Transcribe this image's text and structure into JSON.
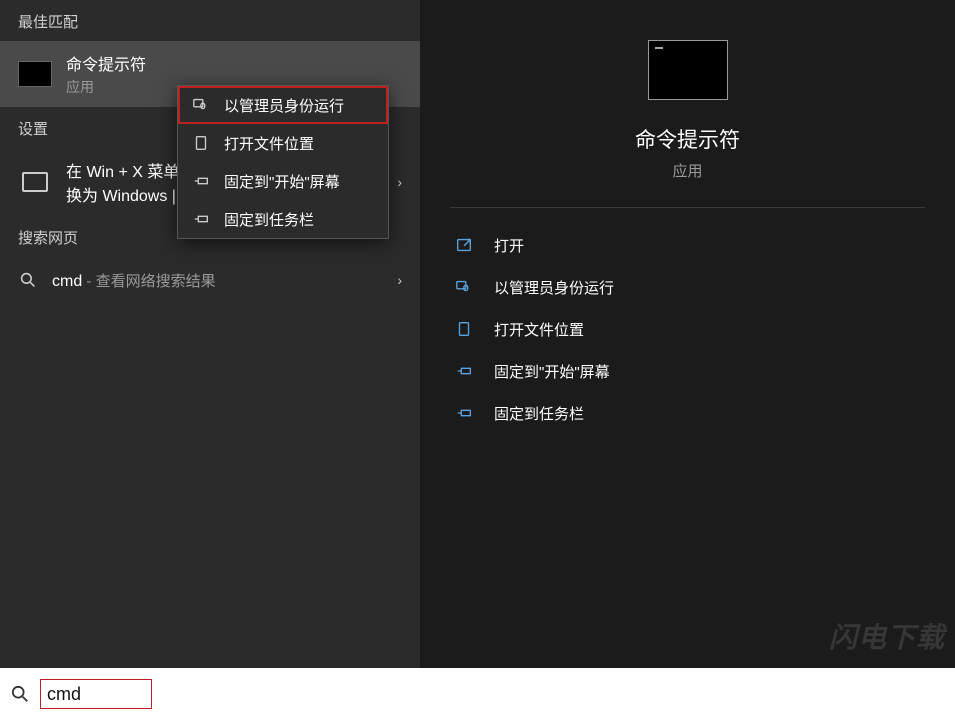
{
  "left": {
    "best_match_header": "最佳匹配",
    "best_match": {
      "title": "命令提示符",
      "subtitle": "应用"
    },
    "settings_header": "设置",
    "settings_item": {
      "line1": "在 Win + X 菜单",
      "line2": "换为 Windows |"
    },
    "web_header": "搜索网页",
    "web_item": {
      "query": "cmd",
      "suffix": " - 查看网络搜索结果"
    }
  },
  "context_menu": {
    "items": [
      {
        "label": "以管理员身份运行",
        "icon": "admin"
      },
      {
        "label": "打开文件位置",
        "icon": "folder"
      },
      {
        "label": "固定到\"开始\"屏幕",
        "icon": "pin-start"
      },
      {
        "label": "固定到任务栏",
        "icon": "pin-taskbar"
      }
    ]
  },
  "preview": {
    "title": "命令提示符",
    "subtitle": "应用",
    "actions": [
      {
        "label": "打开",
        "icon": "open"
      },
      {
        "label": "以管理员身份运行",
        "icon": "admin"
      },
      {
        "label": "打开文件位置",
        "icon": "folder"
      },
      {
        "label": "固定到\"开始\"屏幕",
        "icon": "pin-start"
      },
      {
        "label": "固定到任务栏",
        "icon": "pin-taskbar"
      }
    ]
  },
  "search": {
    "value": "cmd"
  }
}
